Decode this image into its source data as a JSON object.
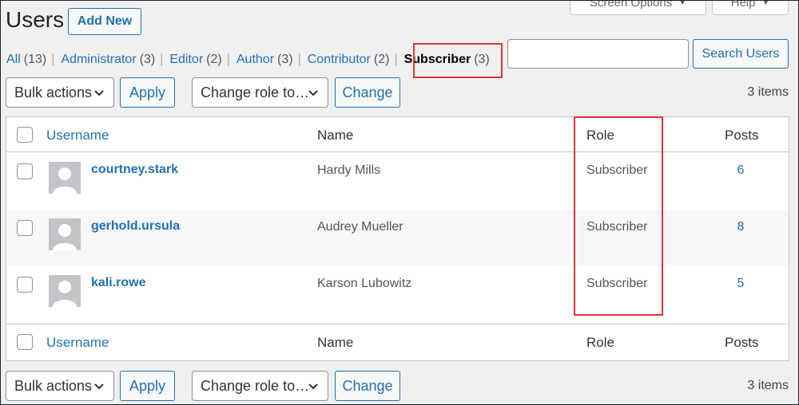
{
  "header": {
    "title": "Users",
    "add_new_label": "Add New",
    "screen_options_label": "Screen Options",
    "help_label": "Help"
  },
  "filters": [
    {
      "label": "All",
      "count": "(13)"
    },
    {
      "label": "Administrator",
      "count": "(3)"
    },
    {
      "label": "Editor",
      "count": "(2)"
    },
    {
      "label": "Author",
      "count": "(3)"
    },
    {
      "label": "Contributor",
      "count": "(2)"
    },
    {
      "label": "Subscriber",
      "count": "(3)",
      "current": true
    }
  ],
  "search": {
    "value": "",
    "button_label": "Search Users"
  },
  "tablenav": {
    "bulk_actions_label": "Bulk actions",
    "apply_label": "Apply",
    "change_role_label": "Change role to…",
    "change_label": "Change",
    "items_count": "3 items"
  },
  "table": {
    "columns": {
      "username": "Username",
      "name": "Name",
      "role": "Role",
      "posts": "Posts"
    },
    "rows": [
      {
        "username": "courtney.stark",
        "name": "Hardy Mills",
        "role": "Subscriber",
        "posts": "6"
      },
      {
        "username": "gerhold.ursula",
        "name": "Audrey Mueller",
        "role": "Subscriber",
        "posts": "8"
      },
      {
        "username": "kali.rowe",
        "name": "Karson Lubowitz",
        "role": "Subscriber",
        "posts": "5"
      }
    ]
  },
  "colors": {
    "link": "#2271b1",
    "highlight": "#d63638",
    "background": "#f0f0f1"
  },
  "icons": {
    "dropdown": "chevron-down-icon",
    "avatar": "default-avatar-icon",
    "tab_caret": "caret-down-icon"
  }
}
